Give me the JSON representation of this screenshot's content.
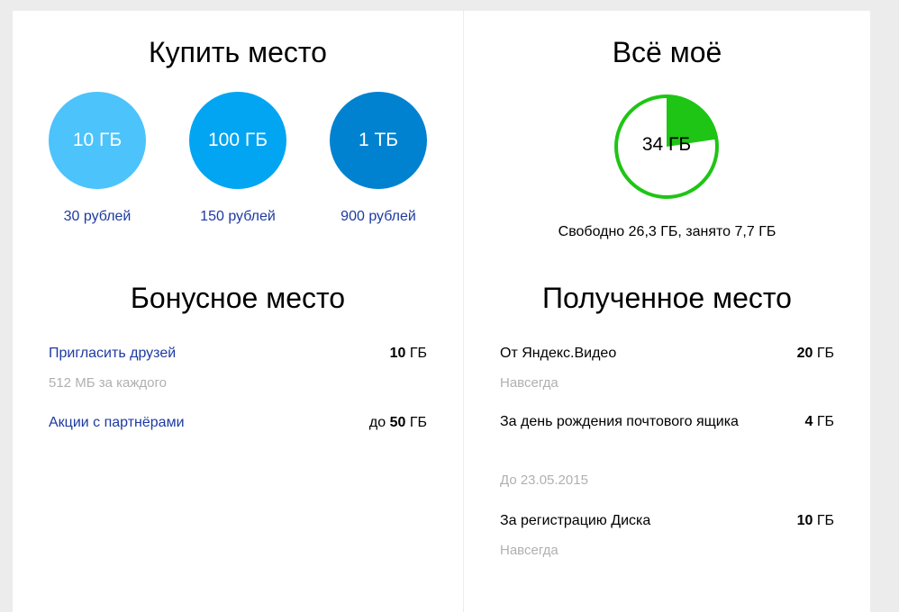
{
  "buy": {
    "title": "Купить место",
    "options": [
      {
        "size": "10 ГБ",
        "price": "30 рублей",
        "color": "#4cc3fb"
      },
      {
        "size": "100 ГБ",
        "price": "150 рублей",
        "color": "#02a5f2"
      },
      {
        "size": "1 ТБ",
        "price": "900 рублей",
        "color": "#0182d0"
      }
    ]
  },
  "mine": {
    "title": "Всё моё",
    "total": "34 ГБ",
    "used_fraction": 0.226,
    "ring_color": "#1ec515",
    "usage_text": "Свободно 26,3 ГБ, занято 7,7 ГБ"
  },
  "bonus": {
    "title": "Бонусное место",
    "items": [
      {
        "label": "Пригласить друзей",
        "prefix": "",
        "amount": "10",
        "unit": "ГБ",
        "note": "512 МБ за каждого"
      },
      {
        "label": "Акции с партнёрами",
        "prefix": "до",
        "amount": "50",
        "unit": "ГБ",
        "note": ""
      }
    ]
  },
  "received": {
    "title": "Полученное место",
    "items": [
      {
        "label": "От Яндекс.Видео",
        "amount": "20",
        "unit": "ГБ",
        "note": "Навсегда"
      },
      {
        "label": "За день рождения почтового ящика",
        "amount": "4",
        "unit": "ГБ",
        "note": "До 23.05.2015"
      },
      {
        "label": "За регистрацию Диска",
        "amount": "10",
        "unit": "ГБ",
        "note": "Навсегда"
      }
    ]
  }
}
